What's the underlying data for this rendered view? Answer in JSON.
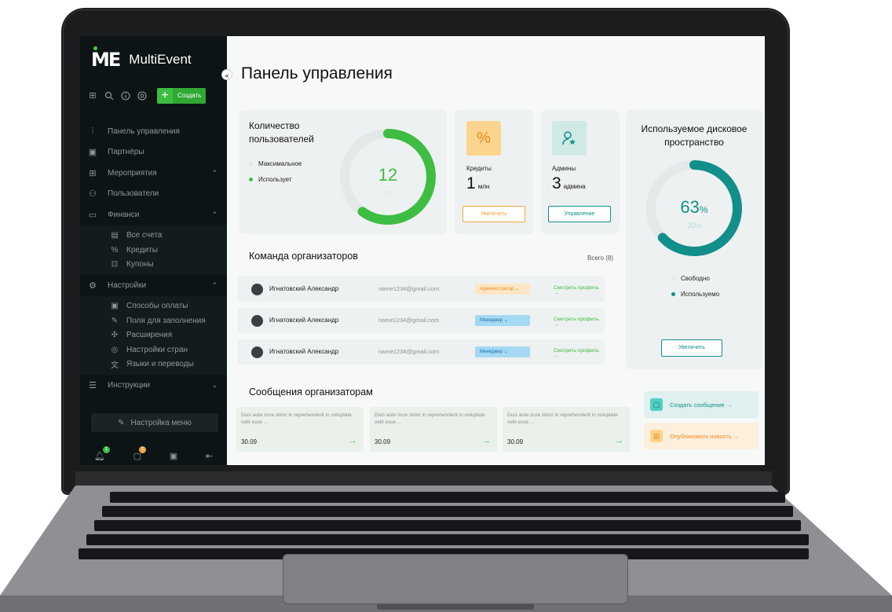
{
  "app": {
    "brand_logo": "ME",
    "brand_name": "MultiEvent",
    "collapse_glyph": "«"
  },
  "toolbar": {
    "icons": [
      "grid-icon",
      "search-icon",
      "info-icon",
      "settings-icon"
    ],
    "create_label": "Создать"
  },
  "sidebar": {
    "items": [
      {
        "label": "Панель управления",
        "icon": "sliders-icon"
      },
      {
        "label": "Партнёры",
        "icon": "briefcase-icon"
      },
      {
        "label": "Мероприятия",
        "icon": "grid-icon"
      },
      {
        "label": "Пользователи",
        "icon": "users-icon"
      },
      {
        "label": "Финанси",
        "icon": "card-icon"
      },
      {
        "label": "Настройки",
        "icon": "gear-icon"
      },
      {
        "label": "Инструкции",
        "icon": "list-icon"
      }
    ],
    "finance_sub": [
      {
        "label": "Все счета",
        "icon": "invoice-icon"
      },
      {
        "label": "Кредиты",
        "icon": "percent-icon"
      },
      {
        "label": "Купоны",
        "icon": "coupon-icon"
      }
    ],
    "settings_sub": [
      {
        "label": "Способы оплаты",
        "icon": "payment-icon"
      },
      {
        "label": "Поля для заполнения",
        "icon": "pen-icon"
      },
      {
        "label": "Расширения",
        "icon": "puzzle-icon"
      },
      {
        "label": "Настройки стран",
        "icon": "compass-icon"
      },
      {
        "label": "Языки и переводы",
        "icon": "translate-icon"
      }
    ],
    "menu_settings": "Настройка меню",
    "bottom_badges": [
      "1",
      "1"
    ]
  },
  "page": {
    "title": "Панель управления"
  },
  "users_card": {
    "title_line1": "Количество",
    "title_line2": "пользователей",
    "legend_max": "Максимальное",
    "legend_used": "Использует",
    "value": "12",
    "max": "20"
  },
  "credits": {
    "icon_glyph": "%",
    "label": "Кредиты",
    "value": "1",
    "unit": "млн",
    "button": "Увеличить"
  },
  "admins": {
    "label": "Админы",
    "value": "3",
    "unit": "админа",
    "button": "Управление"
  },
  "disk": {
    "title_line1": "Используемое дисковое",
    "title_line2": "пространство",
    "percent": "63",
    "percent_sign": "%",
    "total": "20",
    "total_sign": "%",
    "legend_free": "Свободно",
    "legend_used": "Используемо",
    "button": "Увеличить"
  },
  "team": {
    "title": "Команда организаторов",
    "total": "Всего (8)",
    "rows": [
      {
        "name": "Игнатовский Александр",
        "email": "name1234@gmail.com",
        "role": "Администратор",
        "link": "Смотреть профиль"
      },
      {
        "name": "Игнатовский Александр",
        "email": "name1234@gmail.com",
        "role": "Менеджер",
        "link": "Смотреть профиль"
      },
      {
        "name": "Игнатовский Александр",
        "email": "name1234@gmail.com",
        "role": "Менеджер",
        "link": "Смотреть профиль"
      }
    ]
  },
  "messages": {
    "title": "Сообщения организаторам",
    "items": [
      {
        "text": "Duis aute irure dolor in reprehenderit in voluptate velit esse ...",
        "date": "30.09"
      },
      {
        "text": "Duis aute irure dolor in reprehenderit in voluptate velit esse ...",
        "date": "30.09"
      },
      {
        "text": "Duis aute irure dolor in reprehenderit in voluptate velit esse ...",
        "date": "30.09"
      }
    ]
  },
  "actions": {
    "create_message": "Создать сообщение →",
    "publish_news": "Опубликовать новость →"
  },
  "colors": {
    "accent_green": "#3ebd42",
    "accent_teal": "#128f8b",
    "orange": "#f4a340",
    "sidebar_bg": "#0d1416"
  }
}
